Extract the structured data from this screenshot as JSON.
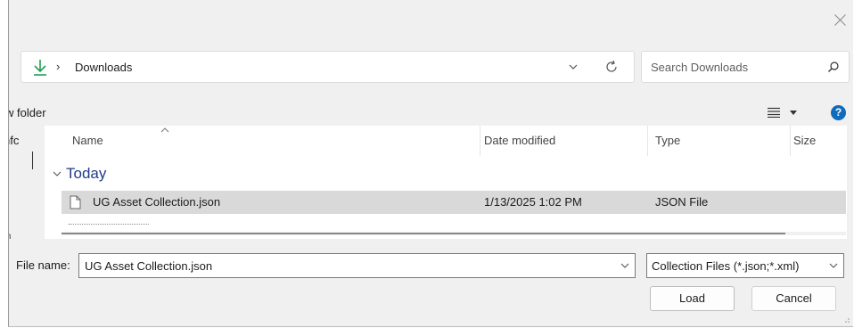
{
  "window": {
    "close_icon": "close-icon"
  },
  "address_bar": {
    "location_icon": "downloads-arrow-icon",
    "separator": "›",
    "location": "Downloads",
    "dropdown_icon": "chevron-down-icon",
    "refresh_icon": "refresh-icon"
  },
  "search": {
    "placeholder": "Search Downloads",
    "icon": "search-icon"
  },
  "toolbar": {
    "new_folder_label": "w folder",
    "view_icon": "list-view-icon",
    "help_label": "?"
  },
  "nav_pane": {
    "item_label": "nfc",
    "bottom_label": "m"
  },
  "file_list": {
    "columns": [
      {
        "label": "Name"
      },
      {
        "label": "Date modified"
      },
      {
        "label": "Type"
      },
      {
        "label": "Size"
      }
    ],
    "group": {
      "label": "Today"
    },
    "rows": [
      {
        "name": "UG Asset Collection.json",
        "date_modified": "1/13/2025 1:02 PM",
        "type": "JSON File",
        "size": ""
      }
    ]
  },
  "footer": {
    "file_name_label": "File name:",
    "file_name_value": "UG Asset Collection.json",
    "filter_value": "Collection Files (*.json;*.xml)",
    "load_label": "Load",
    "cancel_label": "Cancel"
  },
  "colors": {
    "accent": "#0f6cbd",
    "downloads_icon": "#1f9d55",
    "selected_row": "#d9d9d9"
  }
}
